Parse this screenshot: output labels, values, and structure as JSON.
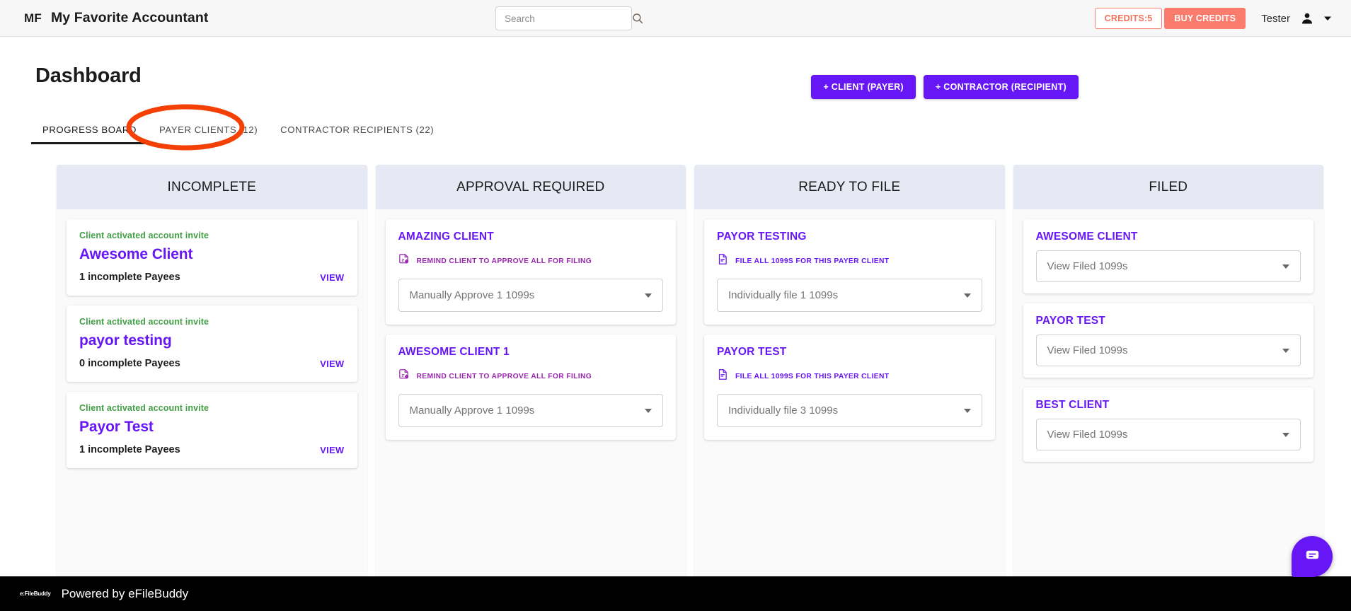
{
  "header": {
    "brand_mark": "MF",
    "brand_title": "My Favorite Accountant",
    "search_placeholder": "Search",
    "search_value": "",
    "credits_label": "CREDITS:5",
    "buy_credits_label": "BUY CREDITS",
    "user_name": "Tester",
    "accent_color": "#6716f5",
    "credits_color": "#fb7c6c"
  },
  "page": {
    "title": "Dashboard",
    "add_client_label": "+ CLIENT (PAYER)",
    "add_contractor_label": "+ CONTRACTOR (RECIPIENT)"
  },
  "tabs": [
    {
      "label": "PROGRESS BOARD",
      "active": true
    },
    {
      "label": "PAYER CLIENTS (12)",
      "active": false
    },
    {
      "label": "CONTRACTOR RECIPIENTS (22)",
      "active": false
    }
  ],
  "annotation": {
    "shape": "ellipse",
    "color": "#f43f05",
    "targets_tab": "PAYER CLIENTS (12)"
  },
  "board": {
    "columns": [
      {
        "title": "INCOMPLETE",
        "kind": "incomplete",
        "cards": [
          {
            "status": "Client activated account invite",
            "name": "Awesome Client",
            "count_label": "1 incomplete Payees",
            "view_label": "VIEW"
          },
          {
            "status": "Client activated account invite",
            "name": "payor testing",
            "count_label": "0 incomplete Payees",
            "view_label": "VIEW"
          },
          {
            "status": "Client activated account invite",
            "name": "Payor Test",
            "count_label": "1 incomplete Payees",
            "view_label": "VIEW"
          }
        ]
      },
      {
        "title": "APPROVAL REQUIRED",
        "kind": "approval",
        "cards": [
          {
            "name": "AMAZING CLIENT",
            "action_label": "REMIND CLIENT TO APPROVE ALL FOR FILING",
            "action_icon": "document-edit-icon",
            "select_value": "Manually Approve 1 1099s"
          },
          {
            "name": "AWESOME CLIENT 1",
            "action_label": "REMIND CLIENT TO APPROVE ALL FOR FILING",
            "action_icon": "document-edit-icon",
            "select_value": "Manually Approve 1 1099s"
          }
        ]
      },
      {
        "title": "READY TO FILE",
        "kind": "ready",
        "cards": [
          {
            "name": "PAYOR TESTING",
            "action_label": "FILE ALL 1099S FOR THIS PAYER CLIENT",
            "action_icon": "document-file-icon",
            "select_value": "Individually file 1 1099s"
          },
          {
            "name": "PAYOR TEST",
            "action_label": "FILE ALL 1099S FOR THIS PAYER CLIENT",
            "action_icon": "document-file-icon",
            "select_value": "Individually file 3 1099s"
          }
        ]
      },
      {
        "title": "FILED",
        "kind": "filed",
        "cards": [
          {
            "name": "AWESOME CLIENT",
            "select_value": "View Filed 1099s"
          },
          {
            "name": "PAYOR TEST",
            "select_value": "View Filed 1099s"
          },
          {
            "name": "BEST CLIENT",
            "select_value": "View Filed 1099s"
          }
        ]
      }
    ]
  },
  "footer": {
    "logo_text": "e:FileBuddy",
    "text": "Powered by eFileBuddy"
  },
  "chat": {
    "icon": "chat-bubble-icon"
  }
}
